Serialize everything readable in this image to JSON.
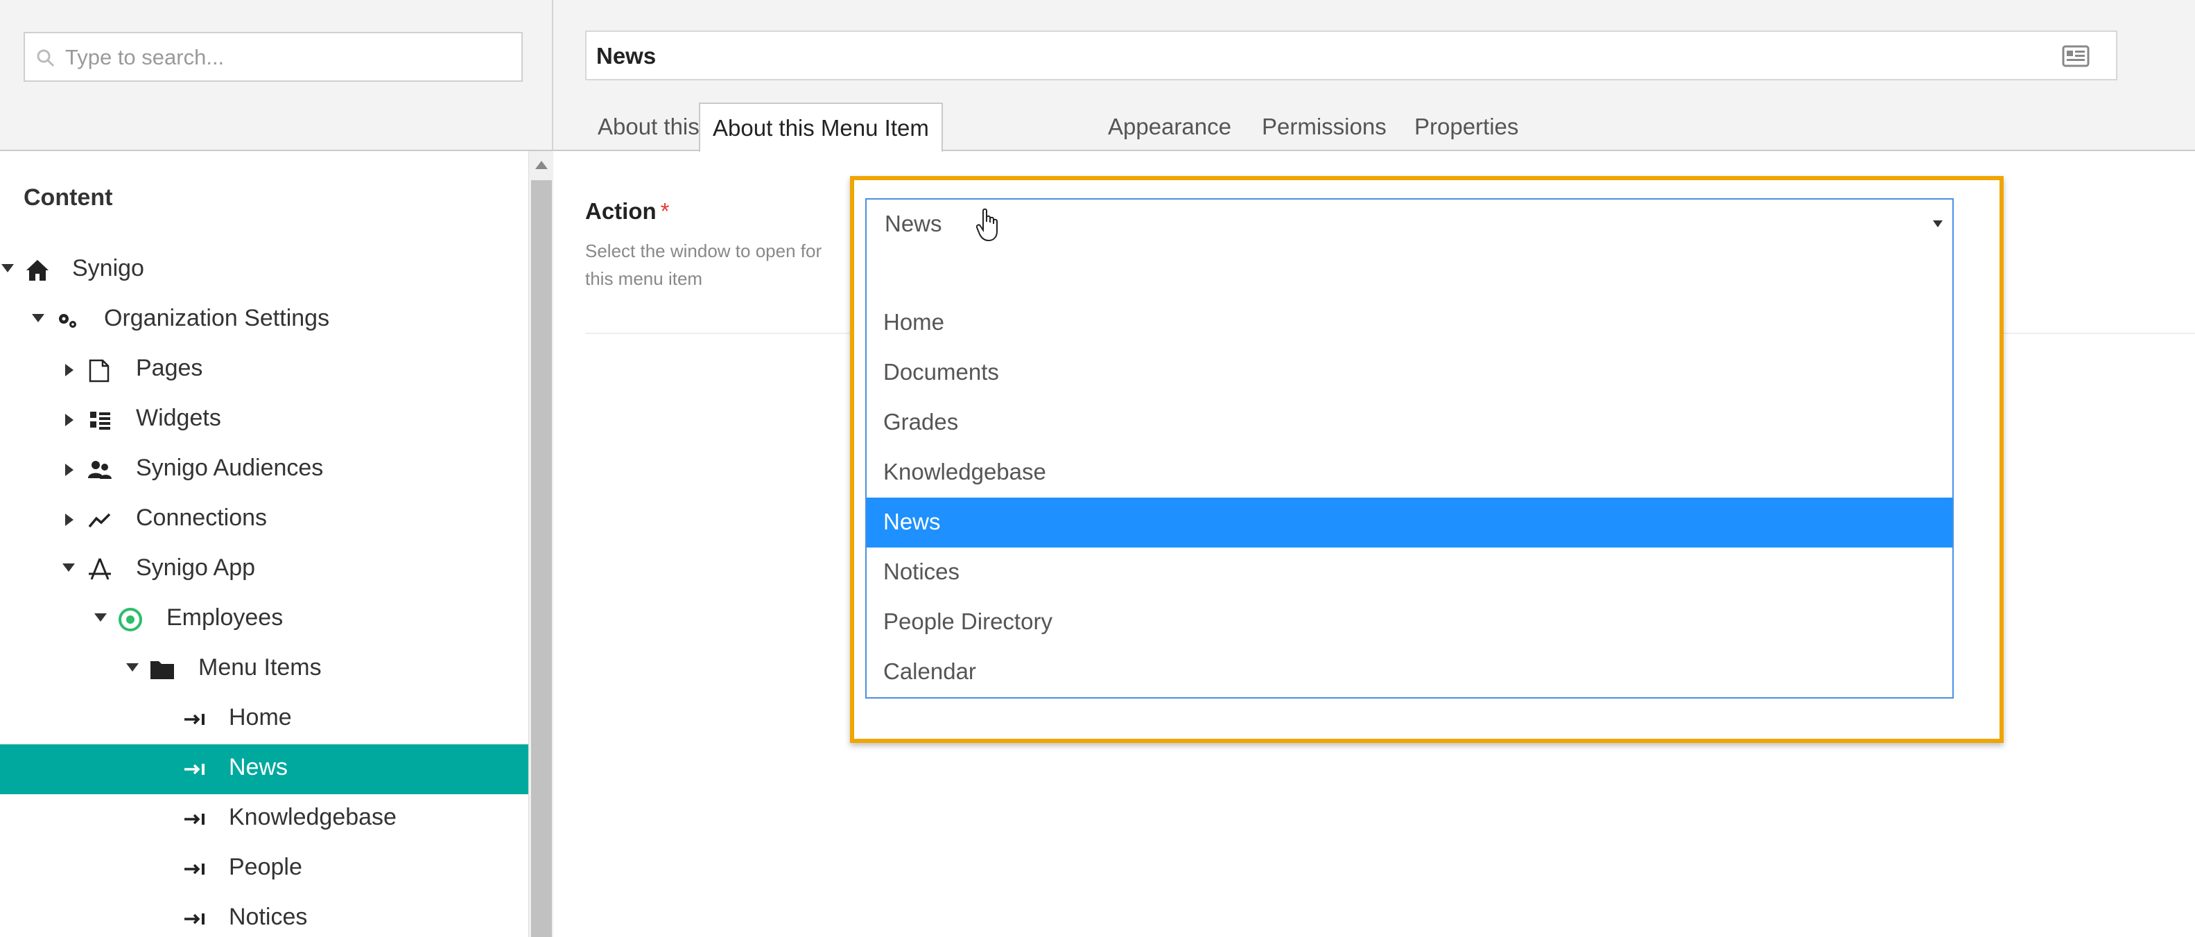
{
  "search": {
    "placeholder": "Type to search..."
  },
  "sidebar": {
    "heading": "Content",
    "tree": [
      {
        "label": "Synigo",
        "icon": "home-icon",
        "expanded": true
      },
      {
        "label": "Organization Settings",
        "icon": "gears-icon",
        "expanded": true
      },
      {
        "label": "Pages",
        "icon": "pages-icon",
        "expanded": false
      },
      {
        "label": "Widgets",
        "icon": "widgets-icon",
        "expanded": false
      },
      {
        "label": "Synigo Audiences",
        "icon": "audiences-icon",
        "expanded": false
      },
      {
        "label": "Connections",
        "icon": "connections-icon",
        "expanded": false
      },
      {
        "label": "Synigo App",
        "icon": "app-store-icon",
        "expanded": true
      },
      {
        "label": "Employees",
        "icon": "target-icon",
        "expanded": true
      },
      {
        "label": "Menu Items",
        "icon": "folder-icon",
        "expanded": true
      },
      {
        "label": "Home",
        "icon": "menu-item-icon"
      },
      {
        "label": "News",
        "icon": "menu-item-icon",
        "selected": true
      },
      {
        "label": "Knowledgebase",
        "icon": "menu-item-icon"
      },
      {
        "label": "People",
        "icon": "menu-item-icon"
      },
      {
        "label": "Notices",
        "icon": "menu-item-icon"
      }
    ]
  },
  "header": {
    "title": "News",
    "tabs": [
      {
        "label": "About this menu item"
      },
      {
        "label": "About this Menu Item",
        "active": true
      },
      {
        "label": "Appearance"
      },
      {
        "label": "Permissions"
      },
      {
        "label": "Properties"
      }
    ]
  },
  "form": {
    "action_label": "Action",
    "required_mark": "*",
    "action_help": "Select the window to open for this menu item",
    "selected_value": "News",
    "options": [
      "",
      "Home",
      "Documents",
      "Grades",
      "Knowledgebase",
      "News",
      "Notices",
      "People Directory",
      "Calendar"
    ],
    "selected_index": 5
  },
  "colors": {
    "tree_selected": "#00a99d",
    "option_selected": "#1e90ff",
    "highlight_frame": "#f0a500",
    "required": "#e53935"
  }
}
